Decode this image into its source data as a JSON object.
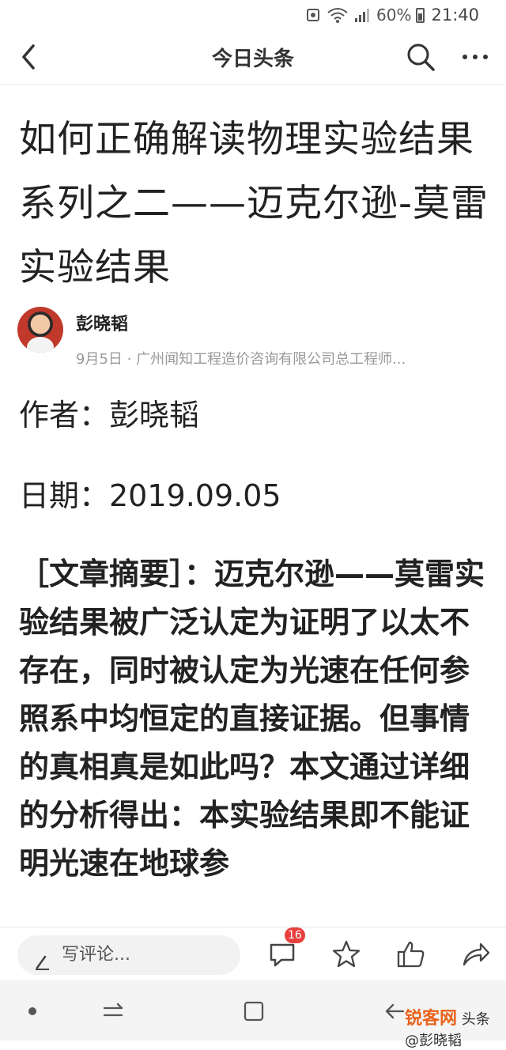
{
  "status_bar": {
    "battery": "60%",
    "time": "21:40"
  },
  "app_bar": {
    "title": "今日头条"
  },
  "article": {
    "headline": "如何正确解读物理实验结果系列之二——迈克尔逊-莫雷实验结果",
    "author_name": "彭晓韬",
    "meta": "9月5日 · 广州闻知工程造价咨询有限公司总工程师...",
    "author_line": "作者：彭晓韬",
    "date_line": "日期：2019.09.05",
    "summary": "［文章摘要］：迈克尔逊——莫雷实验结果被广泛认定为证明了以太不存在，同时被认定为光速在任何参照系中均恒定的直接证据。但事情的真相真是如此吗？本文通过详细的分析得出：本实验结果即不能证明光速在地球参"
  },
  "comment_bar": {
    "placeholder": "写评论...",
    "comment_count": "16"
  },
  "watermark": {
    "brand": "锐客网",
    "text": "头条 @彭晓韬"
  },
  "colors": {
    "badge": "#e8403d",
    "text": "#222222",
    "meta": "#999999"
  }
}
